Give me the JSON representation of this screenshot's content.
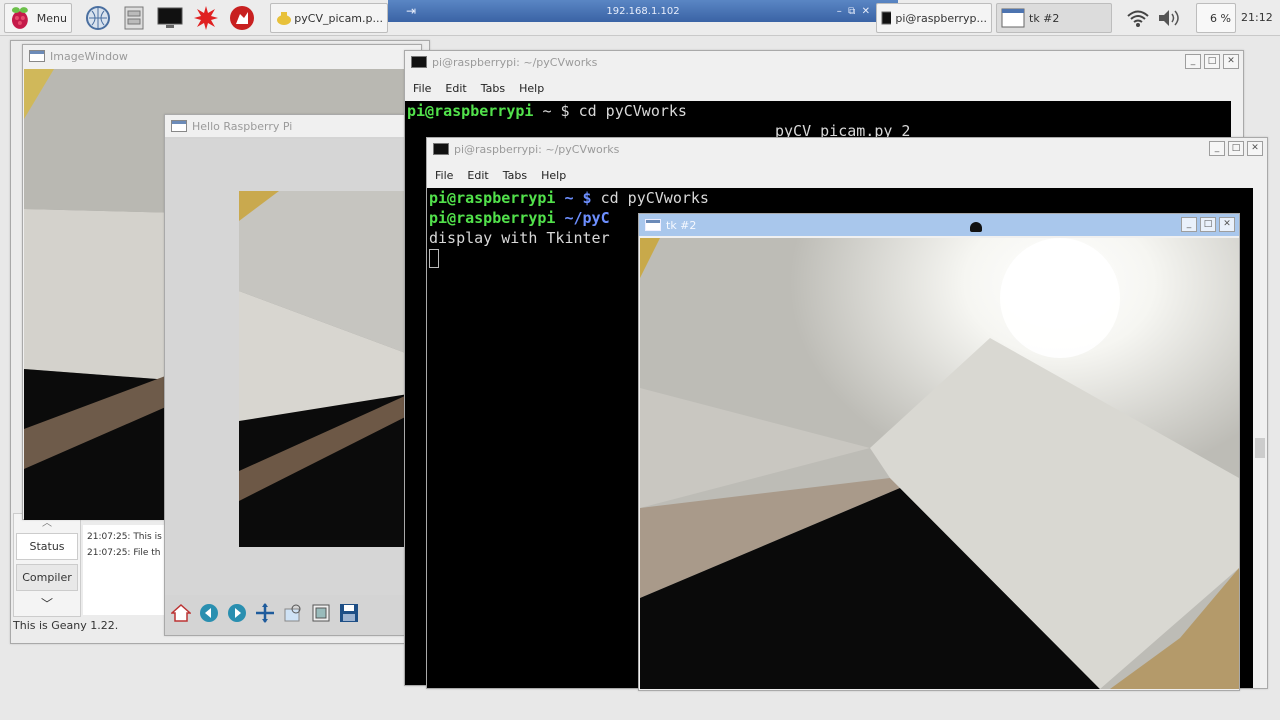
{
  "panel": {
    "menu_label": "Menu",
    "tasks": [
      {
        "label": "pyCV_picam.p..."
      },
      {
        "label": "pi@raspberryp..."
      },
      {
        "label": "tk #2"
      }
    ],
    "vnc_title": "192.168.1.102",
    "cpu": "6 %",
    "clock": "21:12"
  },
  "image_window": {
    "title": "ImageWindow"
  },
  "geany": {
    "tabs": [
      "Status",
      "Compiler"
    ],
    "messages": [
      "21:07:25: This is",
      "21:07:25: File th"
    ],
    "statusbar": "This is Geany 1.22."
  },
  "hello": {
    "title": "Hello Raspberry Pi"
  },
  "term_back": {
    "title": "pi@raspberrypi: ~/pyCVworks",
    "menu": [
      "File",
      "Edit",
      "Tabs",
      "Help"
    ],
    "line1_prompt": "pi@raspberrypi",
    "line1_rest": " ~ $ cd pyCVworks",
    "line2_visible": "pyCV_picam.py 2"
  },
  "term_front": {
    "title": "pi@raspberrypi: ~/pyCVworks",
    "menu": [
      "File",
      "Edit",
      "Tabs",
      "Help"
    ],
    "l1_user": "pi@raspberrypi",
    "l1_path": " ~ $",
    "l1_cmd": " cd pyCVworks",
    "l2_user": "pi@raspberrypi",
    "l2_path": " ~/pyC",
    "l3": "display with Tkinter"
  },
  "tk2": {
    "title": "tk #2"
  },
  "colors": {
    "accent": "#a9c7ec",
    "term_green": "#52e14b",
    "term_blue": "#6d8fff"
  }
}
